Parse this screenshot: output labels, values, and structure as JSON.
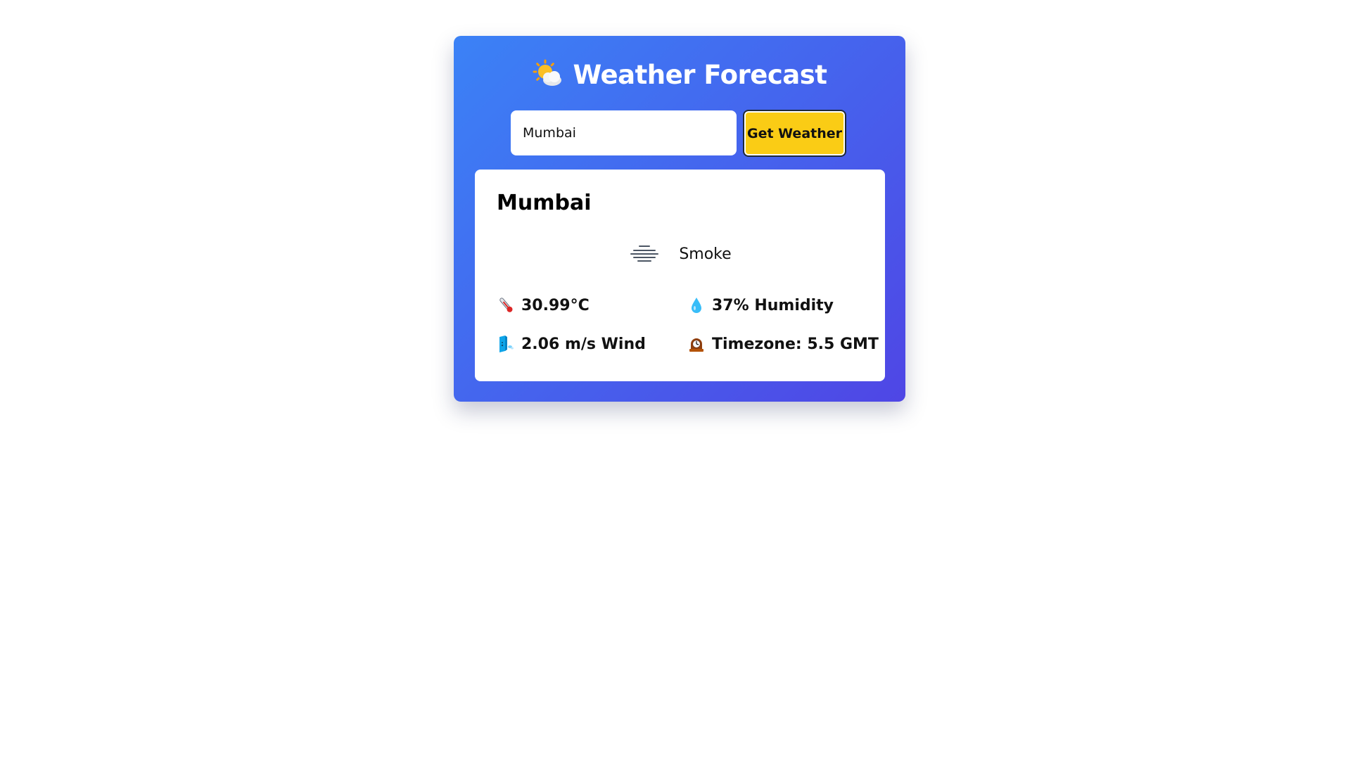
{
  "app": {
    "title": "Weather Forecast",
    "title_icon": "sun-behind-cloud-icon"
  },
  "search": {
    "value": "Mumbai",
    "button_label": "Get Weather"
  },
  "result": {
    "city": "Mumbai",
    "condition": "Smoke",
    "condition_icon": "smoke-haze-icon",
    "temperature": "30.99°C",
    "humidity": "37% Humidity",
    "wind": "2.06 m/s Wind",
    "timezone": "Timezone: 5.5 GMT"
  },
  "colors": {
    "gradient_start": "#3b82f6",
    "gradient_end": "#4f46e5",
    "button_bg": "#facc15",
    "card_bg": "#ffffff"
  }
}
